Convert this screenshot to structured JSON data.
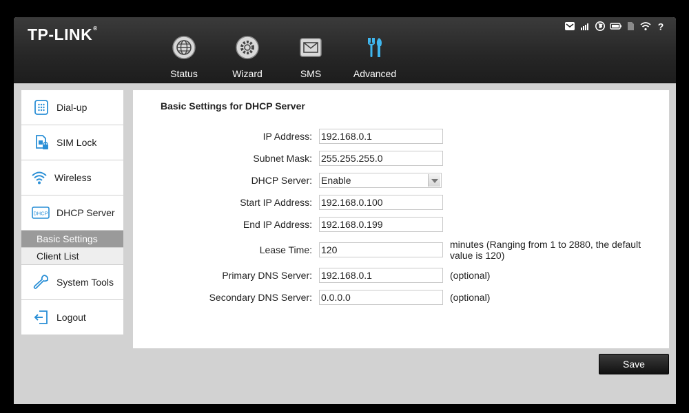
{
  "brand": {
    "name": "TP-LINK",
    "mark": "®"
  },
  "top_nav": [
    {
      "label": "Status",
      "icon": "globe-icon"
    },
    {
      "label": "Wizard",
      "icon": "wizard-gear-icon"
    },
    {
      "label": "SMS",
      "icon": "envelope-icon"
    },
    {
      "label": "Advanced",
      "icon": "tools-icon",
      "active": true
    }
  ],
  "status_icons": [
    "message-icon",
    "signal-icon",
    "internet-globe-icon",
    "battery-icon",
    "sim-card-icon",
    "wifi-icon",
    "help-icon"
  ],
  "sidebar": {
    "items": [
      {
        "label": "Dial-up",
        "icon": "dialpad-icon"
      },
      {
        "label": "SIM Lock",
        "icon": "sim-lock-icon"
      },
      {
        "label": "Wireless",
        "icon": "wifi-icon"
      },
      {
        "label": "DHCP Server",
        "icon": "dhcp-icon",
        "icon_text": "DHCP"
      },
      {
        "label": "System Tools",
        "icon": "wrench-icon"
      },
      {
        "label": "Logout",
        "icon": "logout-icon"
      }
    ],
    "subitems": [
      {
        "label": "Basic Settings",
        "active": true
      },
      {
        "label": "Client List"
      }
    ]
  },
  "form": {
    "title": "Basic Settings for DHCP Server",
    "ip_address": {
      "label": "IP Address:",
      "value": "192.168.0.1"
    },
    "subnet_mask": {
      "label": "Subnet Mask:",
      "value": "255.255.255.0"
    },
    "dhcp_server": {
      "label": "DHCP Server:",
      "value": "Enable"
    },
    "start_ip": {
      "label": "Start IP Address:",
      "value": "192.168.0.100"
    },
    "end_ip": {
      "label": "End IP Address:",
      "value": "192.168.0.199"
    },
    "lease_time": {
      "label": "Lease Time:",
      "value": "120",
      "note": "minutes (Ranging from 1 to 2880, the default value is 120)"
    },
    "primary_dns": {
      "label": "Primary DNS Server:",
      "value": "192.168.0.1",
      "note": "(optional)"
    },
    "secondary_dns": {
      "label": "Secondary DNS Server:",
      "value": "0.0.0.0",
      "note": "(optional)"
    }
  },
  "actions": {
    "save_label": "Save"
  },
  "colors": {
    "header_bg": "#262626",
    "accent_active": "#3fb7ef",
    "page_bg": "#d2d2d2",
    "active_subitem": "#9a9a9a"
  }
}
